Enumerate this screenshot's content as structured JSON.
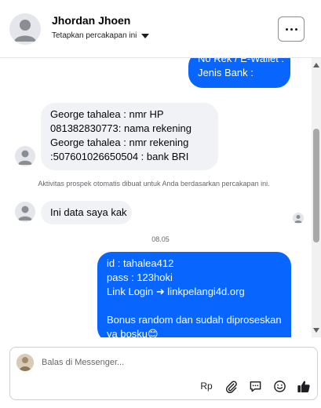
{
  "header": {
    "contact_name": "Jhordan Jhoen",
    "assign_label": "Tetapkan percakapan ini"
  },
  "messages": {
    "outgoing_top": [
      "No Rek / E-Wallet :",
      "Jenis Bank :"
    ],
    "incoming_details": [
      "George tahalea : nmr HP",
      "081382830773: nama rekening",
      "George tahalea : nmr rekening",
      ":507601026650504 : bank BRI"
    ],
    "system_note": "Aktivitas prospek otomatis dibuat untuk Anda berdasarkan percakapan ini.",
    "incoming_short": "Ini data saya kak",
    "timestamp": "08.05",
    "outgoing_bottom": [
      "id : tahalea412",
      "pass : 123hoki",
      "Link Login ➜ linkpelangi4d.org",
      "",
      "Bonus random dan sudah diproseskan",
      "ya bosku😊"
    ]
  },
  "composer": {
    "placeholder": "Balas di Messenger...",
    "currency_label": "Rp"
  },
  "colors": {
    "outgoing_bubble": "#0866ff",
    "incoming_bubble": "#f0f2f5",
    "like_icon": "#0866ff"
  },
  "icons": [
    "person-icon",
    "more-icon",
    "caret-down-icon",
    "attachment-icon",
    "reply-template-icon",
    "emoji-icon",
    "like-icon"
  ]
}
